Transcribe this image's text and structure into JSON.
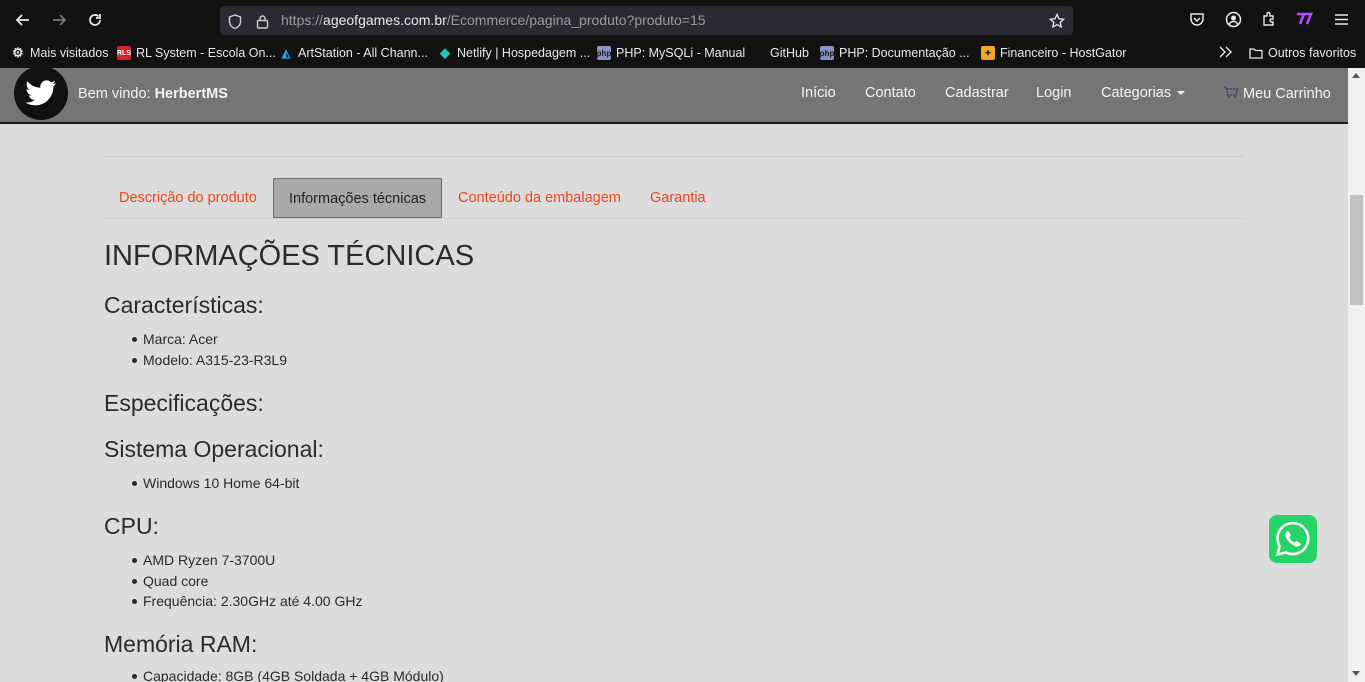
{
  "browser": {
    "url_prefix": "https://",
    "url_domain": "ageofgames.com.br",
    "url_path": "/Ecommerce/pagina_produto?produto=15",
    "bookmarks": [
      {
        "label": "Mais visitados",
        "icon": "gear-icon"
      },
      {
        "label": "RL System - Escola On...",
        "icon": "rls-favicon"
      },
      {
        "label": "ArtStation - All Chann...",
        "icon": "artstation-icon"
      },
      {
        "label": "Netlify | Hospedagem ...",
        "icon": "netlify-icon"
      },
      {
        "label": "PHP: MySQLi - Manual",
        "icon": "php-icon"
      },
      {
        "label": "GitHub",
        "icon": "github-icon"
      },
      {
        "label": "PHP: Documentação ...",
        "icon": "php-icon"
      },
      {
        "label": "Financeiro - HostGator",
        "icon": "hostgator-icon"
      }
    ],
    "other_bookmarks": "Outros favoritos"
  },
  "navbar": {
    "welcome_prefix": "Bem vindo: ",
    "username": "HerbertMS",
    "links": [
      "Início",
      "Contato",
      "Cadastrar",
      "Login",
      "Categorias"
    ],
    "cart": "Meu Carrinho"
  },
  "tabs": [
    "Descrição do produto",
    "Informações técnicas",
    "Conteúdo da embalagem",
    "Garantia"
  ],
  "active_tab": "Informações técnicas",
  "content": {
    "title": "INFORMAÇÕES TÉCNICAS",
    "sections": [
      {
        "heading": "Características:",
        "items": [
          "Marca: Acer",
          "Modelo: A315-23-R3L9"
        ]
      },
      {
        "heading": "Especificações:",
        "items": []
      },
      {
        "heading": "Sistema Operacional:",
        "items": [
          "Windows 10 Home 64-bit"
        ]
      },
      {
        "heading": "CPU:",
        "items": [
          "AMD Ryzen 7-3700U",
          "Quad core",
          "Frequência: 2.30GHz até 4.00 GHz"
        ]
      },
      {
        "heading": "Memória RAM:",
        "items": [
          "Capacidade: 8GB (4GB Soldada + 4GB Módulo)"
        ]
      }
    ]
  },
  "colors": {
    "tab_link": "#e8481b",
    "navbar_bg": "#757575",
    "page_bg": "#dcdcdc",
    "whatsapp": "#25d366"
  }
}
